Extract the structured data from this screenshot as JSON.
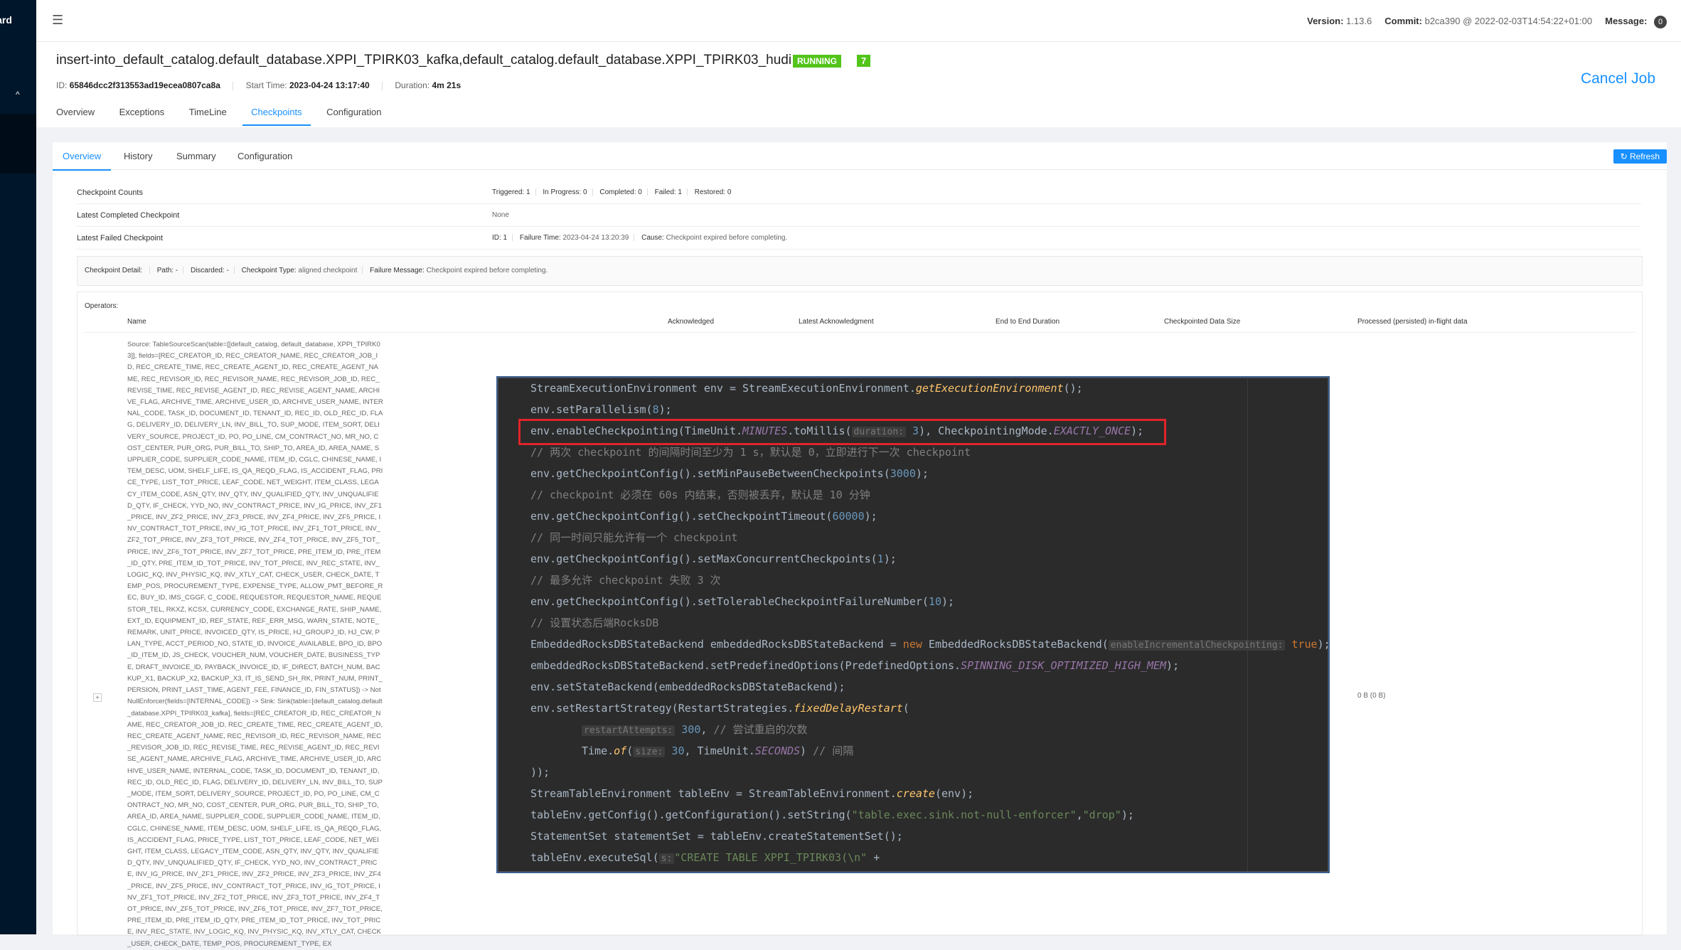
{
  "sidebar": {
    "brand": "board",
    "chevron": "^"
  },
  "topbar": {
    "version_label": "Version:",
    "version_value": "1.13.6",
    "commit_label": "Commit:",
    "commit_value": "b2ca390 @ 2022-02-03T14:54:22+01:00",
    "message_label": "Message:",
    "message_count": "0"
  },
  "job": {
    "title": "insert-into_default_catalog.default_database.XPPI_TPIRK03_kafka,default_catalog.default_database.XPPI_TPIRK03_hudi",
    "status": "RUNNING",
    "count": "7",
    "id_label": "ID:",
    "id_value": "65846dcc2f313553ad19ecea0807ca8a",
    "start_label": "Start Time:",
    "start_value": "2023-04-24 13:17:40",
    "duration_label": "Duration:",
    "duration_value": "4m 21s",
    "cancel": "Cancel Job",
    "tabs": [
      "Overview",
      "Exceptions",
      "TimeLine",
      "Checkpoints",
      "Configuration"
    ]
  },
  "checkpoints": {
    "subtabs": [
      "Overview",
      "History",
      "Summary",
      "Configuration"
    ],
    "refresh": "Refresh",
    "counts_label": "Checkpoint Counts",
    "triggered": "Triggered: 1",
    "in_progress": "In Progress: 0",
    "completed": "Completed: 0",
    "failed": "Failed: 1",
    "restored": "Restored: 0",
    "latest_completed_label": "Latest Completed Checkpoint",
    "latest_completed_value": "None",
    "latest_failed_label": "Latest Failed Checkpoint",
    "failed_id": "ID: 1",
    "failed_time_label": "Failure Time:",
    "failed_time": "2023-04-24 13:20:39",
    "cause_label": "Cause:",
    "cause": "Checkpoint expired before completing.",
    "detail": {
      "label": "Checkpoint Detail:",
      "path": "Path: -",
      "discarded": "Discarded: -",
      "type_label": "Checkpoint Type:",
      "type": "aligned checkpoint",
      "failure_label": "Failure Message:",
      "failure": "Checkpoint expired before completing."
    },
    "operators_label": "Operators:",
    "columns": [
      "Name",
      "Acknowledged",
      "Latest Acknowledgment",
      "End to End Duration",
      "Checkpointed Data Size",
      "Processed (persisted) in-flight data"
    ],
    "operator_name": "Source: TableSourceScan(table=[[default_catalog, default_database, XPPI_TPIRK03]], fields=[REC_CREATOR_ID, REC_CREATOR_NAME, REC_CREATOR_JOB_ID, REC_CREATE_TIME, REC_CREATE_AGENT_ID, REC_CREATE_AGENT_NAME, REC_REVISOR_ID, REC_REVISOR_NAME, REC_REVISOR_JOB_ID, REC_REVISE_TIME, REC_REVISE_AGENT_ID, REC_REVISE_AGENT_NAME, ARCHIVE_FLAG, ARCHIVE_TIME, ARCHIVE_USER_ID, ARCHIVE_USER_NAME, INTERNAL_CODE, TASK_ID, DOCUMENT_ID, TENANT_ID, REC_ID, OLD_REC_ID, FLAG, DELIVERY_ID, DELIVERY_LN, INV_BILL_TO, SUP_MODE, ITEM_SORT, DELIVERY_SOURCE, PROJECT_ID, PO, PO_LINE, CM_CONTRACT_NO, MR_NO, COST_CENTER, PUR_ORG, PUR_BILL_TO, SHIP_TO, AREA_ID, AREA_NAME, SUPPLIER_CODE, SUPPLIER_CODE_NAME, ITEM_ID, CGLC, CHINESE_NAME, ITEM_DESC, UOM, SHELF_LIFE, IS_QA_REQD_FLAG, IS_ACCIDENT_FLAG, PRICE_TYPE, LIST_TOT_PRICE, LEAF_CODE, NET_WEIGHT, ITEM_CLASS, LEGACY_ITEM_CODE, ASN_QTY, INV_QTY, INV_QUALIFIED_QTY, INV_UNQUALIFIED_QTY, IF_CHECK, YYD_NO, INV_CONTRACT_PRICE, INV_IG_PRICE, INV_ZF1_PRICE, INV_ZF2_PRICE, INV_ZF3_PRICE, INV_ZF4_PRICE, INV_ZF5_PRICE, INV_CONTRACT_TOT_PRICE, INV_IG_TOT_PRICE, INV_ZF1_TOT_PRICE, INV_ZF2_TOT_PRICE, INV_ZF3_TOT_PRICE, INV_ZF4_TOT_PRICE, INV_ZF5_TOT_PRICE, INV_ZF6_TOT_PRICE, INV_ZF7_TOT_PRICE, PRE_ITEM_ID, PRE_ITEM_ID_QTY, PRE_ITEM_ID_TOT_PRICE, INV_TOT_PRICE, INV_REC_STATE, INV_LOGIC_KQ, INV_PHYSIC_KQ, INV_XTLY_CAT, CHECK_USER, CHECK_DATE, TEMP_POS, PROCUREMENT_TYPE, EXPENSE_TYPE, ALLOW_PMT_BEFORE_REC, BUY_ID, IMS_CGGF, C_CODE, REQUESTOR, REQUESTOR_NAME, REQUESTOR_TEL, RKXZ, KCSX, CURRENCY_CODE, EXCHANGE_RATE, SHIP_NAME, EXT_ID, EQUIPMENT_ID, REF_STATE, REF_ERR_MSG, WARN_STATE, NOTE_REMARK, UNIT_PRICE, INVOICED_QTY, IS_PRICE, HJ_GROUPJ_ID, HJ_CW, PLAN_TYPE, ACCT_PERIOD_NO, STATE_ID, INVOICE_AVAILABLE, BPO_ID, BPO_ID_ITEM_ID, JS_CHECK, VOUCHER_NUM, VOUCHER_DATE, BUSINESS_TYPE, DRAFT_INVOICE_ID, PAYBACK_INVOICE_ID, IF_DIRECT, BATCH_NUM, BACKUP_X1, BACKUP_X2, BACKUP_X3, IT_IS_SEND_SH_RK, PRINT_NUM, PRINT_PERSION, PRINT_LAST_TIME, AGENT_FEE, FINANCE_ID, FIN_STATUS]) -> NotNullEnforcer(fields=[INTERNAL_CODE]) -> Sink: Sink(table=[default_catalog.default_database.XPPI_TPIRK03_kafka], fields=[REC_CREATOR_ID, REC_CREATOR_NAME, REC_CREATOR_JOB_ID, REC_CREATE_TIME, REC_CREATE_AGENT_ID, REC_CREATE_AGENT_NAME, REC_REVISOR_ID, REC_REVISOR_NAME, REC_REVISOR_JOB_ID, REC_REVISE_TIME, REC_REVISE_AGENT_ID, REC_REVISE_AGENT_NAME, ARCHIVE_FLAG, ARCHIVE_TIME, ARCHIVE_USER_ID, ARCHIVE_USER_NAME, INTERNAL_CODE, TASK_ID, DOCUMENT_ID, TENANT_ID, REC_ID, OLD_REC_ID, FLAG, DELIVERY_ID, DELIVERY_LN, INV_BILL_TO, SUP_MODE, ITEM_SORT, DELIVERY_SOURCE, PROJECT_ID, PO, PO_LINE, CM_CONTRACT_NO, MR_NO, COST_CENTER, PUR_ORG, PUR_BILL_TO, SHIP_TO, AREA_ID, AREA_NAME, SUPPLIER_CODE, SUPPLIER_CODE_NAME, ITEM_ID, CGLC, CHINESE_NAME, ITEM_DESC, UOM, SHELF_LIFE, IS_QA_REQD_FLAG, IS_ACCIDENT_FLAG, PRICE_TYPE, LIST_TOT_PRICE, LEAF_CODE, NET_WEIGHT, ITEM_CLASS, LEGACY_ITEM_CODE, ASN_QTY, INV_QTY, INV_QUALIFIED_QTY, INV_UNQUALIFIED_QTY, IF_CHECK, YYD_NO, INV_CONTRACT_PRICE, INV_IG_PRICE, INV_ZF1_PRICE, INV_ZF2_PRICE, INV_ZF3_PRICE, INV_ZF4_PRICE, INV_ZF5_PRICE, INV_CONTRACT_TOT_PRICE, INV_IG_TOT_PRICE, INV_ZF1_TOT_PRICE, INV_ZF2_TOT_PRICE, INV_ZF3_TOT_PRICE, INV_ZF4_TOT_PRICE, INV_ZF5_TOT_PRICE, INV_ZF6_TOT_PRICE, INV_ZF7_TOT_PRICE, PRE_ITEM_ID, PRE_ITEM_ID_QTY, PRE_ITEM_ID_TOT_PRICE, INV_TOT_PRICE, INV_REC_STATE, INV_LOGIC_KQ, INV_PHYSIC_KQ, INV_XTLY_CAT, CHECK_USER, CHECK_DATE, TEMP_POS, PROCUREMENT_TYPE, EX",
    "persisted_value": "0 B (0 B)"
  },
  "code": {
    "l1a": "StreamExecutionEnvironment env = StreamExecutionEnvironment.",
    "l1b": "getExecutionEnvironment",
    "l1c": "();",
    "l2a": "env.setParallelism(",
    "l2b": "8",
    "l2c": ");",
    "l3a": "env.enableCheckpointing(TimeUnit.",
    "l3b": "MINUTES",
    "l3c": ".toMillis(",
    "l3h": "duration:",
    "l3d": "3",
    "l3e": "), CheckpointingMode.",
    "l3f": "EXACTLY_ONCE",
    "l3g": ");",
    "l4": "// 两次 checkpoint 的间隔时间至少为 1 s，默认是 0，立即进行下一次 checkpoint",
    "l5a": "env.getCheckpointConfig().setMinPauseBetweenCheckpoints(",
    "l5b": "3000",
    "l5c": ");",
    "l6": "// checkpoint 必须在 60s 内结束，否则被丢弃，默认是 10 分钟",
    "l7a": "env.getCheckpointConfig().setCheckpointTimeout(",
    "l7b": "60000",
    "l7c": ");",
    "l8": "// 同一时间只能允许有一个 checkpoint",
    "l9a": "env.getCheckpointConfig().setMaxConcurrentCheckpoints(",
    "l9b": "1",
    "l9c": ");",
    "l10": "// 最多允许 checkpoint 失败 3 次",
    "l11a": "env.getCheckpointConfig().setTolerableCheckpointFailureNumber(",
    "l11b": "10",
    "l11c": ");",
    "l12": "// 设置状态后端RocksDB",
    "l13a": "EmbeddedRocksDBStateBackend embeddedRocksDBStateBackend = ",
    "l13k": "new",
    "l13b": " EmbeddedRocksDBStateBackend(",
    "l13h": "enableIncrementalCheckpointing:",
    "l13c": "true",
    "l13d": ");",
    "l14a": "embeddedRocksDBStateBackend.setPredefinedOptions(PredefinedOptions.",
    "l14b": "SPINNING_DISK_OPTIMIZED_HIGH_MEM",
    "l14c": ");",
    "l15": "env.setStateBackend(embeddedRocksDBStateBackend);",
    "l16a": "env.setRestartStrategy(RestartStrategies.",
    "l16b": "fixedDelayRestart",
    "l16c": "(",
    "l17h": "restartAttempts:",
    "l17a": "300",
    "l17b": ", ",
    "l17c": "// 尝试重启的次数",
    "l18a": "Time.",
    "l18b": "of",
    "l18c": "(",
    "l18h": "size:",
    "l18d": "30",
    "l18e": ", TimeUnit.",
    "l18f": "SECONDS",
    "l18g": ") ",
    "l18i": "// 间隔",
    "l19": "));",
    "l20a": "StreamTableEnvironment tableEnv = StreamTableEnvironment.",
    "l20b": "create",
    "l20c": "(env);",
    "l21a": "tableEnv.getConfig().getConfiguration().setString(",
    "l21b": "\"table.exec.sink.not-null-enforcer\"",
    "l21c": ",",
    "l21d": "\"drop\"",
    "l21e": ");",
    "l22a": "StatementSet statementSet = tableEnv.createStatementSet();",
    "l23a": "tableEnv.executeSql(",
    "l23h": "s:",
    "l23b": "\"CREATE TABLE XPPI_TPIRK03(\\n\"",
    "l23c": " +"
  }
}
